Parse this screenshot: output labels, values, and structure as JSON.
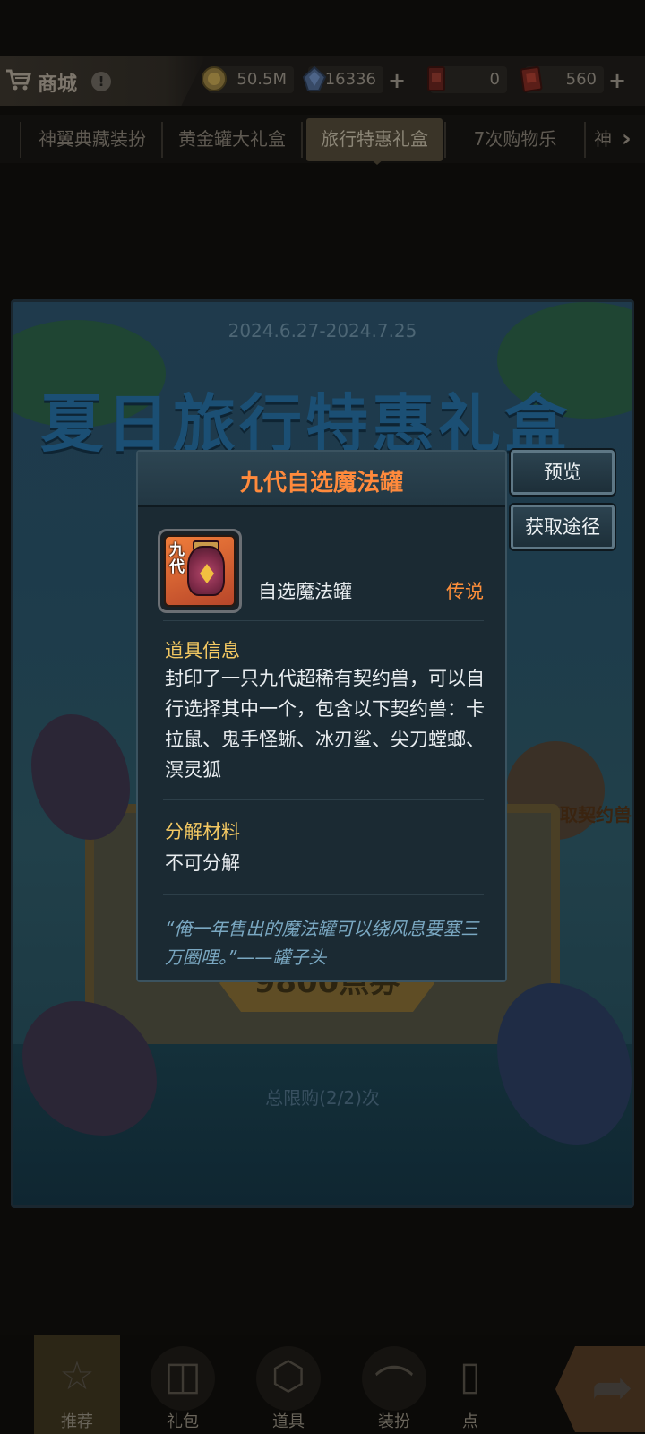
{
  "topbar": {
    "shop_label": "商城",
    "help": "!",
    "currencies": [
      {
        "icon": "gold-coin-icon",
        "value": "50.5M",
        "plus": ""
      },
      {
        "icon": "blue-crystal-icon",
        "value": "16336",
        "plus": "+"
      },
      {
        "icon": "red-ticket-icon",
        "value": "0",
        "plus": ""
      },
      {
        "icon": "red-coupon-icon",
        "value": "560",
        "plus": "+"
      }
    ]
  },
  "tabs": [
    {
      "label": "神翼典藏装扮",
      "active": false
    },
    {
      "label": "黄金罐大礼盒",
      "active": false
    },
    {
      "label": "旅行特惠礼盒",
      "active": true
    },
    {
      "label": "7次购物乐",
      "active": false
    },
    {
      "label": "神",
      "active": false
    }
  ],
  "banner": {
    "date": "2024.6.27-2024.7.25",
    "title": "夏日旅行特惠礼盒",
    "price": "9800点券",
    "limit": "总限购(2/2)次",
    "side_badge": "获取契约兽"
  },
  "popup": {
    "title": "九代自选魔法罐",
    "item_badge": "九代",
    "item_name": "自选魔法罐",
    "rarity": "传说",
    "info_title": "道具信息",
    "info_body": "封印了一只九代超稀有契约兽，可以自行选择其中一个，包含以下契约兽：卡拉鼠、鬼手怪蜥、冰刃鲨、尖刀螳螂、溟灵狐",
    "decompose_title": "分解材料",
    "decompose_body": "不可分解",
    "quote": "“俺一年售出的魔法罐可以绕风息要塞三万圈哩。”——罐子头"
  },
  "side_buttons": {
    "preview": "预览",
    "obtain": "获取途径"
  },
  "bottomnav": [
    {
      "label": "推荐",
      "icon": "star-icon",
      "active": true
    },
    {
      "label": "礼包",
      "icon": "gift-icon",
      "active": false
    },
    {
      "label": "道具",
      "icon": "item-icon",
      "active": false
    },
    {
      "label": "装扮",
      "icon": "hanger-icon",
      "active": false
    },
    {
      "label": "点",
      "icon": "card-icon",
      "active": false
    }
  ],
  "colors": {
    "title_orange": "#ff8a3c",
    "rarity_orange": "#ff8f3a",
    "section_gold": "#f3c862",
    "quote_blue": "#7aa8c2"
  }
}
